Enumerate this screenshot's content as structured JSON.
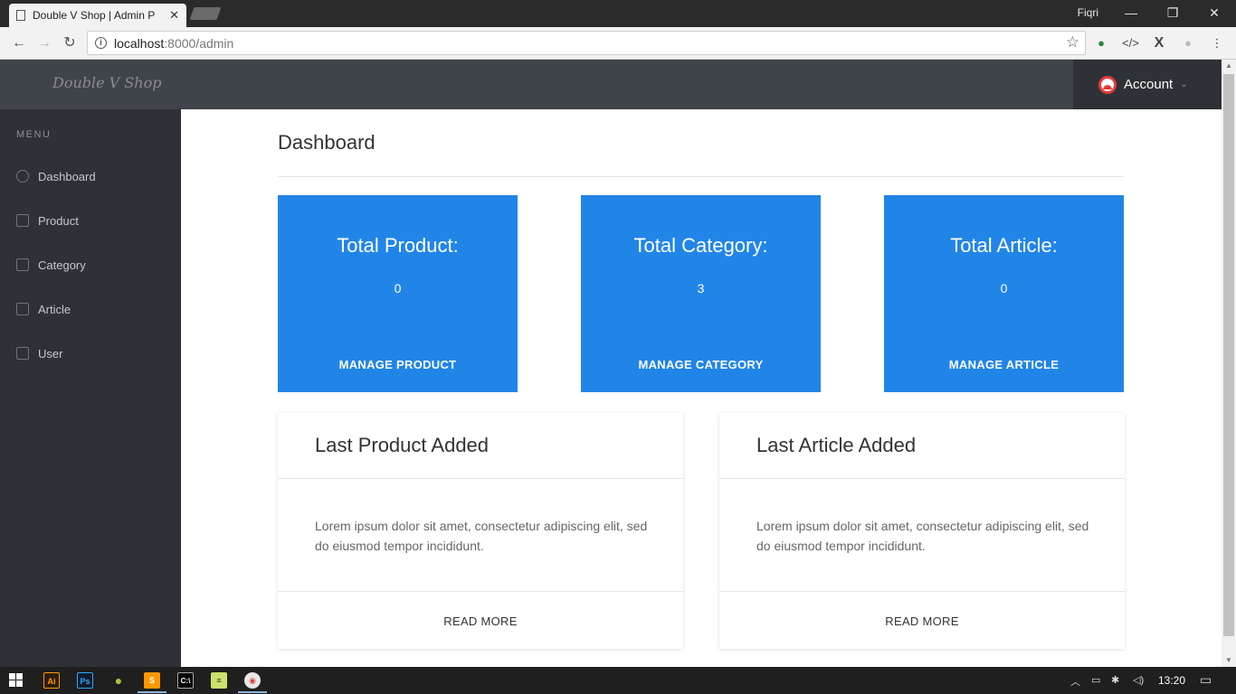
{
  "browser": {
    "tab_title": "Double V Shop | Admin P",
    "profile_name": "Fiqri",
    "url_host": "localhost",
    "url_path": ":8000/admin"
  },
  "header": {
    "brand": "Double V Shop",
    "account_label": "Account"
  },
  "sidebar": {
    "menu_label": "MENU",
    "items": [
      {
        "label": "Dashboard",
        "icon": "dashboard-icon"
      },
      {
        "label": "Product",
        "icon": "bookmark-icon"
      },
      {
        "label": "Category",
        "icon": "bookmark-icon"
      },
      {
        "label": "Article",
        "icon": "bookmark-icon"
      },
      {
        "label": "User",
        "icon": "image-icon"
      }
    ]
  },
  "main": {
    "title": "Dashboard",
    "stats": [
      {
        "title": "Total Product:",
        "value": "0",
        "link": "MANAGE PRODUCT"
      },
      {
        "title": "Total Category:",
        "value": "3",
        "link": "MANAGE CATEGORY"
      },
      {
        "title": "Total Article:",
        "value": "0",
        "link": "MANAGE ARTICLE"
      }
    ],
    "panels": [
      {
        "title": "Last Product Added",
        "text": "Lorem ipsum dolor sit amet, consectetur adipiscing elit, sed do eiusmod tempor incididunt.",
        "link": "READ MORE"
      },
      {
        "title": "Last Article Added",
        "text": "Lorem ipsum dolor sit amet, consectetur adipiscing elit, sed do eiusmod tempor incididunt.",
        "link": "READ MORE"
      }
    ]
  },
  "taskbar": {
    "clock": "13:20"
  },
  "colors": {
    "accent": "#2185e8",
    "header_bg": "#3f434a",
    "sidebar_bg": "#2e3136"
  }
}
